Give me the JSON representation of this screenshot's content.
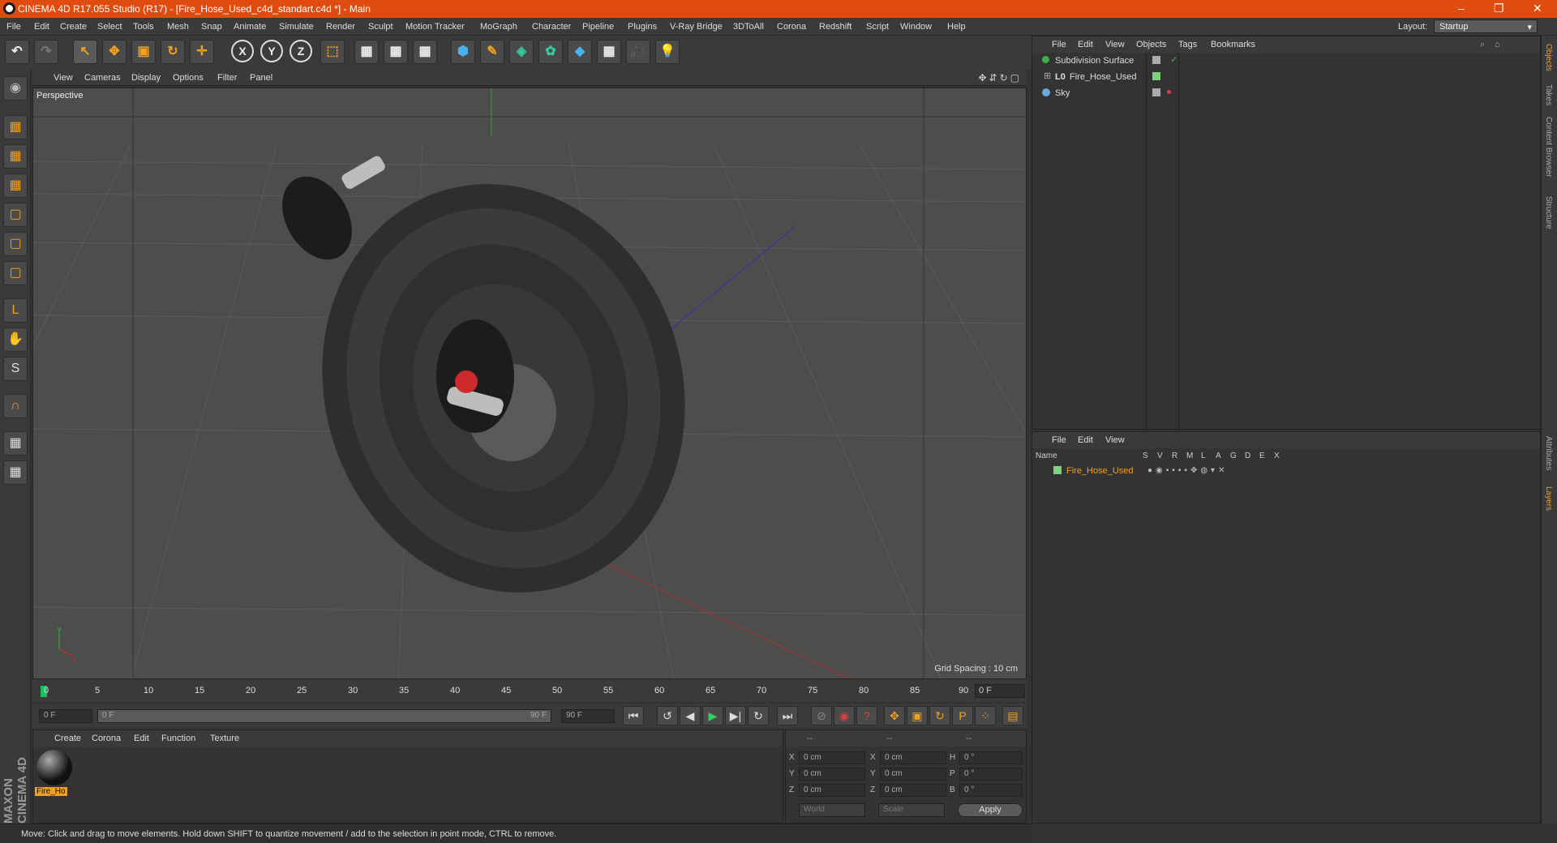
{
  "window": {
    "title": "CINEMA 4D R17.055 Studio (R17) - [Fire_Hose_Used_c4d_standart.c4d *] - Main",
    "controls": [
      "–",
      "❐",
      "✕"
    ]
  },
  "menubar": {
    "items": [
      "File",
      "Edit",
      "Create",
      "Select",
      "Tools",
      "Mesh",
      "Snap",
      "Animate",
      "Simulate",
      "Render",
      "Sculpt",
      "Motion Tracker",
      "MoGraph",
      "Character",
      "Pipeline",
      "Plugins",
      "V-Ray Bridge",
      "3DToAll",
      "Corona",
      "Redshift",
      "Script",
      "Window",
      "Help"
    ],
    "layout_label": "Layout:",
    "layout_value": "Startup"
  },
  "toolbar": {
    "undo": "↶",
    "redo": "↷",
    "select": "↖",
    "move": "✥",
    "scale": "▣",
    "rotate": "↻",
    "live": "✛",
    "x": "X",
    "y": "Y",
    "z": "Z",
    "coord": "⬚",
    "render_view": "▦",
    "render_pv": "▦",
    "render_settings": "▦",
    "cube": "⬢",
    "pen": "✎",
    "subdiv": "◈",
    "cloner": "✿",
    "deformer": "◆",
    "floor": "▦",
    "camera": "🎥",
    "light": "💡"
  },
  "left_tools": [
    "◉",
    "▦",
    "▦",
    "▦",
    "▢",
    "▢",
    "▢",
    "L",
    "✋",
    "S",
    "∩",
    "▦",
    "▦"
  ],
  "viewport": {
    "menu": [
      "View",
      "Cameras",
      "Display",
      "Options",
      "Filter",
      "Panel"
    ],
    "nav_icons": "✥⇵↻▢",
    "label": "Perspective",
    "grid_spacing": "Grid Spacing : 10 cm"
  },
  "timeline": {
    "ticks": [
      "0",
      "5",
      "10",
      "15",
      "20",
      "25",
      "30",
      "35",
      "40",
      "45",
      "50",
      "55",
      "60",
      "65",
      "70",
      "75",
      "80",
      "85",
      "90"
    ],
    "current_frame": "0 F"
  },
  "transport": {
    "start": "0 F",
    "range_start": "0 F",
    "range_end": "90 F",
    "end": "90 F",
    "buttons": [
      "⏮",
      "↺",
      "◀",
      "▶",
      "▶|",
      "↻",
      "⏭"
    ],
    "key_buttons": [
      "⊘",
      "◉",
      "?",
      "✥",
      "▣",
      "↻",
      "P",
      "⁘",
      "▤"
    ]
  },
  "materials": {
    "menu": [
      "Create",
      "Corona",
      "Edit",
      "Function",
      "Texture"
    ],
    "items": [
      {
        "name": "Fire_Ho"
      }
    ],
    "brand": "MAXON CINEMA 4D"
  },
  "coords": {
    "headers": [
      "--",
      "--",
      "--"
    ],
    "rows": [
      {
        "a": "X",
        "av": "0 cm",
        "b": "X",
        "bv": "0 cm",
        "c": "H",
        "cv": "0 °"
      },
      {
        "a": "Y",
        "av": "0 cm",
        "b": "Y",
        "bv": "0 cm",
        "c": "P",
        "cv": "0 °"
      },
      {
        "a": "Z",
        "av": "0 cm",
        "b": "Z",
        "bv": "0 cm",
        "c": "B",
        "cv": "0 °"
      }
    ],
    "world": "World",
    "scale": "Scale",
    "apply": "Apply"
  },
  "status": {
    "text": "Move: Click and drag to move elements. Hold down SHIFT to quantize movement / add to the selection in point mode, CTRL to remove."
  },
  "objects": {
    "menu": [
      "File",
      "Edit",
      "View",
      "Objects",
      "Tags",
      "Bookmarks"
    ],
    "rows": [
      {
        "name": "Subdivision Surface",
        "color": "#3fae4a"
      },
      {
        "name": "Fire_Hose_Used",
        "color": "#7fd07f"
      },
      {
        "name": "Sky",
        "color": "#6aa8e0"
      }
    ]
  },
  "layers": {
    "menu": [
      "File",
      "Edit",
      "View"
    ],
    "columns": [
      "Name",
      "S",
      "V",
      "R",
      "M",
      "L",
      "A",
      "G",
      "D",
      "E",
      "X"
    ],
    "rows": [
      {
        "name": "Fire_Hose_Used",
        "color": "#7fd07f"
      }
    ]
  },
  "right_tabs": [
    "Objects",
    "Takes",
    "Content Browser",
    "Structure",
    "Attributes",
    "Layers"
  ]
}
